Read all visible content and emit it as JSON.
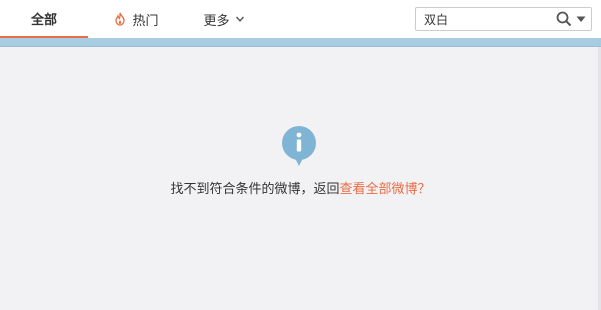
{
  "tabs": {
    "all_label": "全部",
    "hot_label": "热门",
    "more_label": "更多"
  },
  "search": {
    "value": "双白",
    "placeholder": ""
  },
  "icons": {
    "hot": "fire-icon",
    "more": "chevron-down-icon",
    "search": "search-icon",
    "search_options": "caret-down-icon",
    "empty_state": "info-icon"
  },
  "empty_state": {
    "message": "找不到符合条件的微博，返回",
    "link": "查看全部微博？"
  },
  "colors": {
    "accent": "#e86c45",
    "info_icon": "#7fb4d4",
    "strip": "#a8cde2",
    "background": "#f2f2f5"
  }
}
